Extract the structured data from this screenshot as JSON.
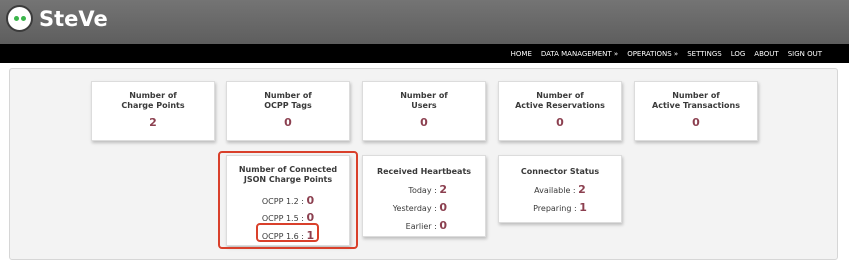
{
  "app": {
    "title": "SteVe"
  },
  "nav": [
    "HOME",
    "DATA MANAGEMENT »",
    "OPERATIONS »",
    "SETTINGS",
    "LOG",
    "ABOUT",
    "SIGN OUT"
  ],
  "tiles": {
    "charge_points": {
      "title_line1": "Number of",
      "title_line2": "Charge Points",
      "value": "2"
    },
    "ocpp_tags": {
      "title_line1": "Number of",
      "title_line2": "OCPP Tags",
      "value": "0"
    },
    "users": {
      "title_line1": "Number of",
      "title_line2": "Users",
      "value": "0"
    },
    "active_reservations": {
      "title_line1": "Number of",
      "title_line2": "Active Reservations",
      "value": "0"
    },
    "active_transactions": {
      "title_line1": "Number of",
      "title_line2": "Active Transactions",
      "value": "0"
    }
  },
  "connected_json": {
    "title_line1": "Number of Connected",
    "title_line2": "JSON Charge Points",
    "rows": [
      {
        "label": "OCPP 1.2 :",
        "value": "0"
      },
      {
        "label": "OCPP 1.5 :",
        "value": "0"
      },
      {
        "label": "OCPP 1.6 :",
        "value": "1"
      }
    ]
  },
  "heartbeats": {
    "title": "Received Heartbeats",
    "rows": [
      {
        "label": "Today :",
        "value": "2"
      },
      {
        "label": "Yesterday :",
        "value": "0"
      },
      {
        "label": "Earlier :",
        "value": "0"
      }
    ]
  },
  "connector_status": {
    "title": "Connector Status",
    "rows": [
      {
        "label": "Available :",
        "value": "2"
      },
      {
        "label": "Preparing :",
        "value": "1"
      }
    ]
  },
  "colors": {
    "accent_value": "#8b3f4f",
    "highlight": "#d9402b",
    "header": "#6b6b6b",
    "navbar": "#000000"
  }
}
